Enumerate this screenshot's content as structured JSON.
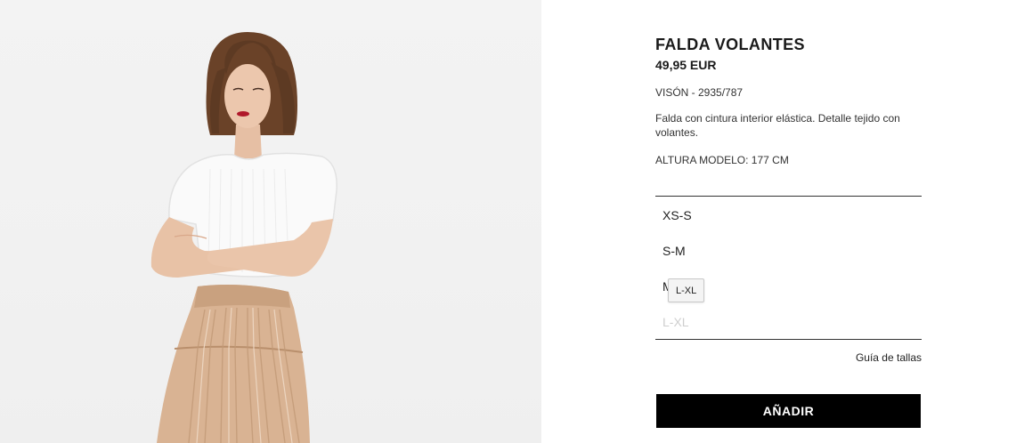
{
  "product": {
    "image_alt": "Model wearing white knit top and pleated skirt",
    "title": "FALDA VOLANTES",
    "price": "49,95 EUR",
    "color_ref": "VISÓN - 2935/787",
    "description": "Falda con cintura interior elástica. Detalle tejido con volantes.",
    "model_height": "ALTURA MODELO: 177 CM"
  },
  "sizes": {
    "items": [
      {
        "label": "XS-S",
        "available": true
      },
      {
        "label": "S-M",
        "available": true
      },
      {
        "label": "M",
        "available": true
      },
      {
        "label": "L-XL",
        "available": false
      }
    ],
    "tooltip": "L-XL"
  },
  "size_guide_label": "Guía de tallas",
  "add_button_label": "AÑADIR",
  "colors": {
    "button_bg": "#000000",
    "unavailable_text": "#cfcfcf",
    "skirt": "#d9b393"
  }
}
